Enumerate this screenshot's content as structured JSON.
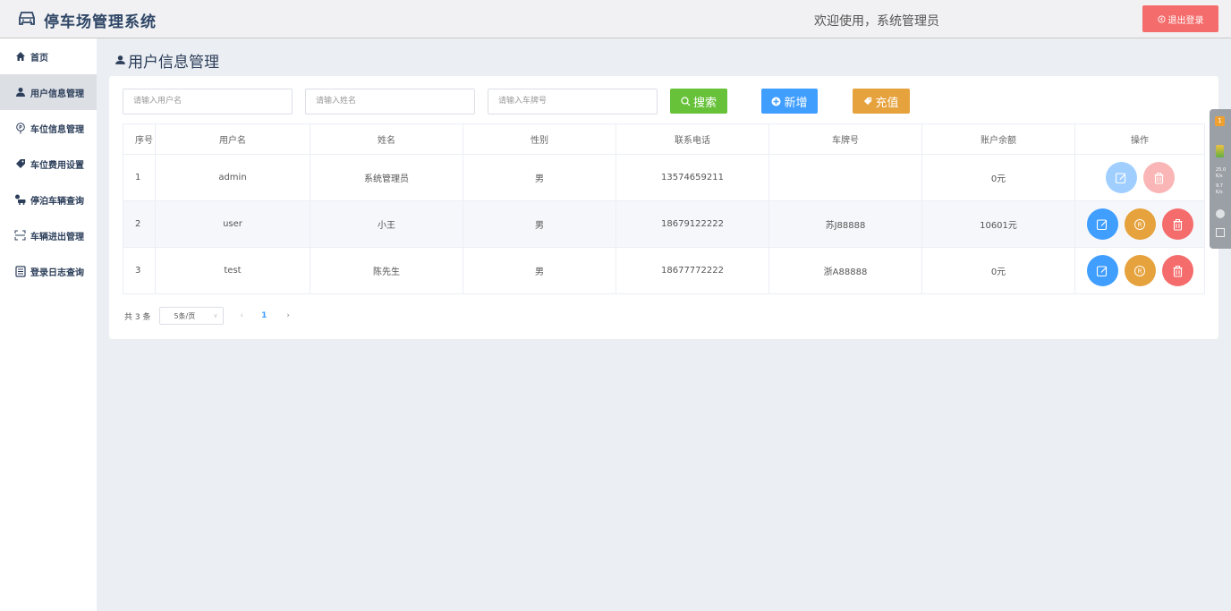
{
  "header": {
    "title": "停车场管理系统",
    "welcome": "欢迎使用，系统管理员",
    "logout_label": "退出登录"
  },
  "sidebar": {
    "items": [
      {
        "label": "首页",
        "icon": "home-icon"
      },
      {
        "label": "用户信息管理",
        "icon": "user-icon"
      },
      {
        "label": "车位信息管理",
        "icon": "location-icon"
      },
      {
        "label": "车位费用设置",
        "icon": "price-tag-icon"
      },
      {
        "label": "停泊车辆查询",
        "icon": "car-search-icon"
      },
      {
        "label": "车辆进出管理",
        "icon": "scan-icon"
      },
      {
        "label": "登录日志查询",
        "icon": "document-icon"
      }
    ]
  },
  "main": {
    "page_title": "用户信息管理",
    "search": {
      "username_placeholder": "请输入用户名",
      "name_placeholder": "请输入姓名",
      "plate_placeholder": "请输入车牌号"
    },
    "buttons": {
      "search": "搜索",
      "add": "新增",
      "charge": "充值"
    },
    "table": {
      "headers": [
        "序号",
        "用户名",
        "姓名",
        "性别",
        "联系电话",
        "车牌号",
        "账户余额",
        "操作"
      ],
      "rows": [
        {
          "idx": "1",
          "username": "admin",
          "name": "系统管理员",
          "gender": "男",
          "phone": "13574659211",
          "plate": "",
          "balance": "0元"
        },
        {
          "idx": "2",
          "username": "user",
          "name": "小王",
          "gender": "男",
          "phone": "18679122222",
          "plate": "苏J88888",
          "balance": "10601元"
        },
        {
          "idx": "3",
          "username": "test",
          "name": "陈先生",
          "gender": "男",
          "phone": "18677772222",
          "plate": "浙A88888",
          "balance": "0元"
        }
      ]
    },
    "pagination": {
      "total": "共 3 条",
      "page_size": "5条/页",
      "current_page": "1"
    }
  },
  "float_widget": {
    "badge": "1",
    "up_speed": "25.0",
    "up_unit": "K/s",
    "down_speed": "9.7",
    "down_unit": "K/s"
  },
  "colors": {
    "primary": "#409eff",
    "success": "#67c23a",
    "warning": "#e6a23c",
    "danger": "#f56c6c",
    "title": "#2f4666"
  }
}
